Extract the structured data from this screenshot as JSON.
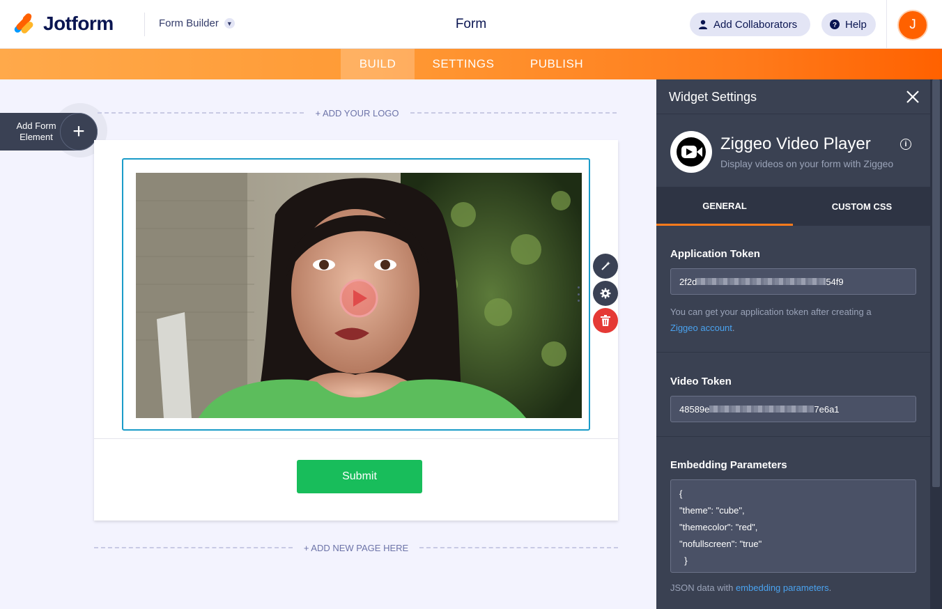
{
  "app": {
    "brand": "Jotform",
    "builder_menu": "Form Builder",
    "form_title": "Form",
    "add_collaborators": "Add Collaborators",
    "help": "Help",
    "avatar_initial": "J"
  },
  "nav": {
    "tabs": [
      {
        "label": "BUILD",
        "active": true
      },
      {
        "label": "SETTINGS",
        "active": false
      },
      {
        "label": "PUBLISH",
        "active": false
      }
    ]
  },
  "canvas": {
    "add_logo": "+ ADD YOUR LOGO",
    "add_element": "Add Form Element",
    "add_element_line1": "Add Form",
    "add_element_line2": "Element",
    "add_page": "+ ADD NEW PAGE HERE",
    "submit_label": "Submit"
  },
  "panel": {
    "title": "Widget Settings",
    "widget_name": "Ziggeo Video Player",
    "widget_desc": "Display videos on your form with Ziggeo",
    "tabs": [
      {
        "label": "GENERAL",
        "active": true
      },
      {
        "label": "CUSTOM CSS",
        "active": false
      }
    ],
    "app_token": {
      "label": "Application Token",
      "value_start": "2f2d",
      "value_end": "54f9",
      "hint_text": "You can get your application token after creating a",
      "hint_link": "Ziggeo account",
      "hint_end": "."
    },
    "video_token": {
      "label": "Video Token",
      "value_start": "48589e",
      "value_end": "7e6a1"
    },
    "embedding": {
      "label": "Embedding Parameters",
      "value": "{\n\"theme\": \"cube\",\n\"themecolor\": \"red\",\n\"nofullscreen\": \"true\"\n  }",
      "hint_text": "JSON data with",
      "hint_link": "embedding parameters",
      "hint_end": "."
    }
  },
  "colors": {
    "brand_navy": "#0a1551",
    "orange": "#ff6100",
    "submit_green": "#18bd5b",
    "selection_blue": "#1a9bc8",
    "panel_bg": "#3a4152",
    "link_blue": "#4aa3f0",
    "delete_red": "#e53935"
  }
}
